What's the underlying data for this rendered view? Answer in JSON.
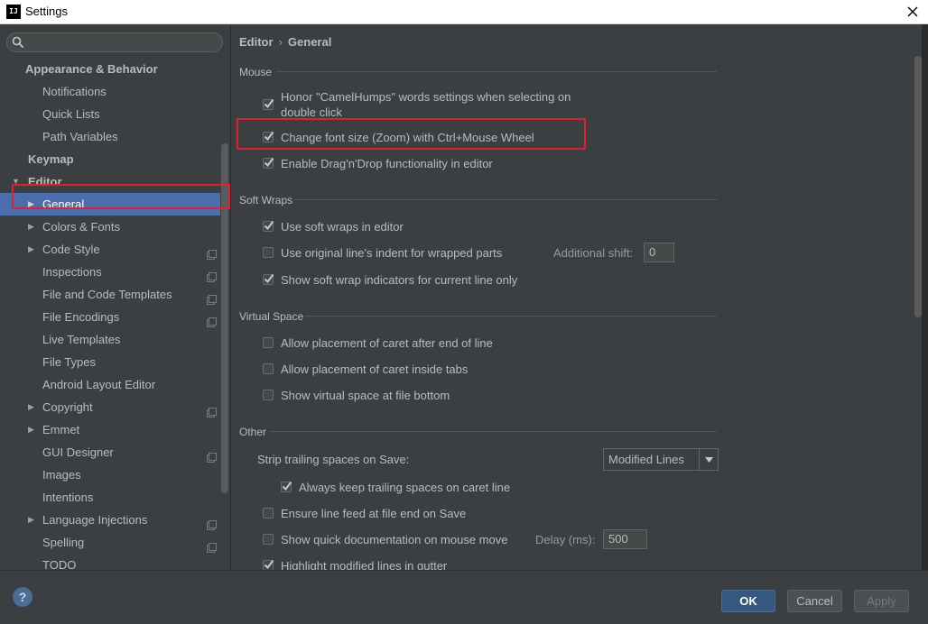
{
  "window": {
    "title": "Settings",
    "icon_text": "IJ"
  },
  "sidebar": {
    "search_placeholder": "",
    "items": [
      {
        "label": "Appearance & Behavior",
        "level": 0,
        "bold": true,
        "arrow": "",
        "project": false,
        "selected": false
      },
      {
        "label": "Notifications",
        "level": 2,
        "bold": false,
        "arrow": "",
        "project": false,
        "selected": false
      },
      {
        "label": "Quick Lists",
        "level": 2,
        "bold": false,
        "arrow": "",
        "project": false,
        "selected": false
      },
      {
        "label": "Path Variables",
        "level": 2,
        "bold": false,
        "arrow": "",
        "project": false,
        "selected": false
      },
      {
        "label": "Keymap",
        "level": 1,
        "bold": true,
        "arrow": "",
        "project": false,
        "selected": false
      },
      {
        "label": "Editor",
        "level": 1,
        "bold": true,
        "arrow": "▼",
        "project": false,
        "selected": false
      },
      {
        "label": "General",
        "level": 2,
        "bold": false,
        "arrow": "▶",
        "project": false,
        "selected": true
      },
      {
        "label": "Colors & Fonts",
        "level": 2,
        "bold": false,
        "arrow": "▶",
        "project": false,
        "selected": false
      },
      {
        "label": "Code Style",
        "level": 2,
        "bold": false,
        "arrow": "▶",
        "project": true,
        "selected": false
      },
      {
        "label": "Inspections",
        "level": 2,
        "bold": false,
        "arrow": "",
        "project": true,
        "selected": false
      },
      {
        "label": "File and Code Templates",
        "level": 2,
        "bold": false,
        "arrow": "",
        "project": true,
        "selected": false
      },
      {
        "label": "File Encodings",
        "level": 2,
        "bold": false,
        "arrow": "",
        "project": true,
        "selected": false
      },
      {
        "label": "Live Templates",
        "level": 2,
        "bold": false,
        "arrow": "",
        "project": false,
        "selected": false
      },
      {
        "label": "File Types",
        "level": 2,
        "bold": false,
        "arrow": "",
        "project": false,
        "selected": false
      },
      {
        "label": "Android Layout Editor",
        "level": 2,
        "bold": false,
        "arrow": "",
        "project": false,
        "selected": false
      },
      {
        "label": "Copyright",
        "level": 2,
        "bold": false,
        "arrow": "▶",
        "project": true,
        "selected": false
      },
      {
        "label": "Emmet",
        "level": 2,
        "bold": false,
        "arrow": "▶",
        "project": false,
        "selected": false
      },
      {
        "label": "GUI Designer",
        "level": 2,
        "bold": false,
        "arrow": "",
        "project": true,
        "selected": false
      },
      {
        "label": "Images",
        "level": 2,
        "bold": false,
        "arrow": "",
        "project": false,
        "selected": false
      },
      {
        "label": "Intentions",
        "level": 2,
        "bold": false,
        "arrow": "",
        "project": false,
        "selected": false
      },
      {
        "label": "Language Injections",
        "level": 2,
        "bold": false,
        "arrow": "▶",
        "project": true,
        "selected": false
      },
      {
        "label": "Spelling",
        "level": 2,
        "bold": false,
        "arrow": "",
        "project": true,
        "selected": false
      },
      {
        "label": "TODO",
        "level": 2,
        "bold": false,
        "arrow": "",
        "project": false,
        "selected": false
      }
    ]
  },
  "breadcrumb": {
    "parent": "Editor",
    "separator": "›",
    "current": "General"
  },
  "sections": {
    "mouse": "Mouse",
    "soft_wraps": "Soft Wraps",
    "virtual_space": "Virtual Space",
    "other": "Other"
  },
  "options": {
    "camel_humps_line1": "Honor \"CamelHumps\" words settings when selecting on",
    "camel_humps_line2": "double click",
    "zoom": "Change font size (Zoom) with Ctrl+Mouse Wheel",
    "dnd": "Enable Drag'n'Drop functionality in editor",
    "soft_wraps": "Use soft wraps in editor",
    "original_indent": "Use original line's indent for wrapped parts",
    "additional_shift_label": "Additional shift:",
    "additional_shift_value": "0",
    "soft_wrap_indicators": "Show soft wrap indicators for current line only",
    "caret_after_eol": "Allow placement of caret after end of line",
    "caret_inside_tabs": "Allow placement of caret inside tabs",
    "virtual_space_bottom": "Show virtual space at file bottom",
    "strip_trailing_label": "Strip trailing spaces on Save:",
    "strip_trailing_value": "Modified Lines",
    "keep_trailing": "Always keep trailing spaces on caret line",
    "ensure_line_feed": "Ensure line feed at file end on Save",
    "quick_doc": "Show quick documentation on mouse move",
    "delay_label": "Delay (ms):",
    "delay_value": "500",
    "highlight_modified": "Highlight modified lines in gutter"
  },
  "checked": {
    "camel_humps": true,
    "zoom": true,
    "dnd": true,
    "soft_wraps": true,
    "original_indent": false,
    "soft_wrap_indicators": true,
    "caret_after_eol": false,
    "caret_inside_tabs": false,
    "virtual_space_bottom": false,
    "keep_trailing": true,
    "ensure_line_feed": false,
    "quick_doc": false,
    "highlight_modified": true
  },
  "buttons": {
    "ok": "OK",
    "cancel": "Cancel",
    "apply": "Apply",
    "help": "?"
  },
  "colors": {
    "background": "#3c3f41",
    "selection": "#4b6eaf",
    "highlight_box": "#e0202a",
    "default_button": "#365880"
  }
}
